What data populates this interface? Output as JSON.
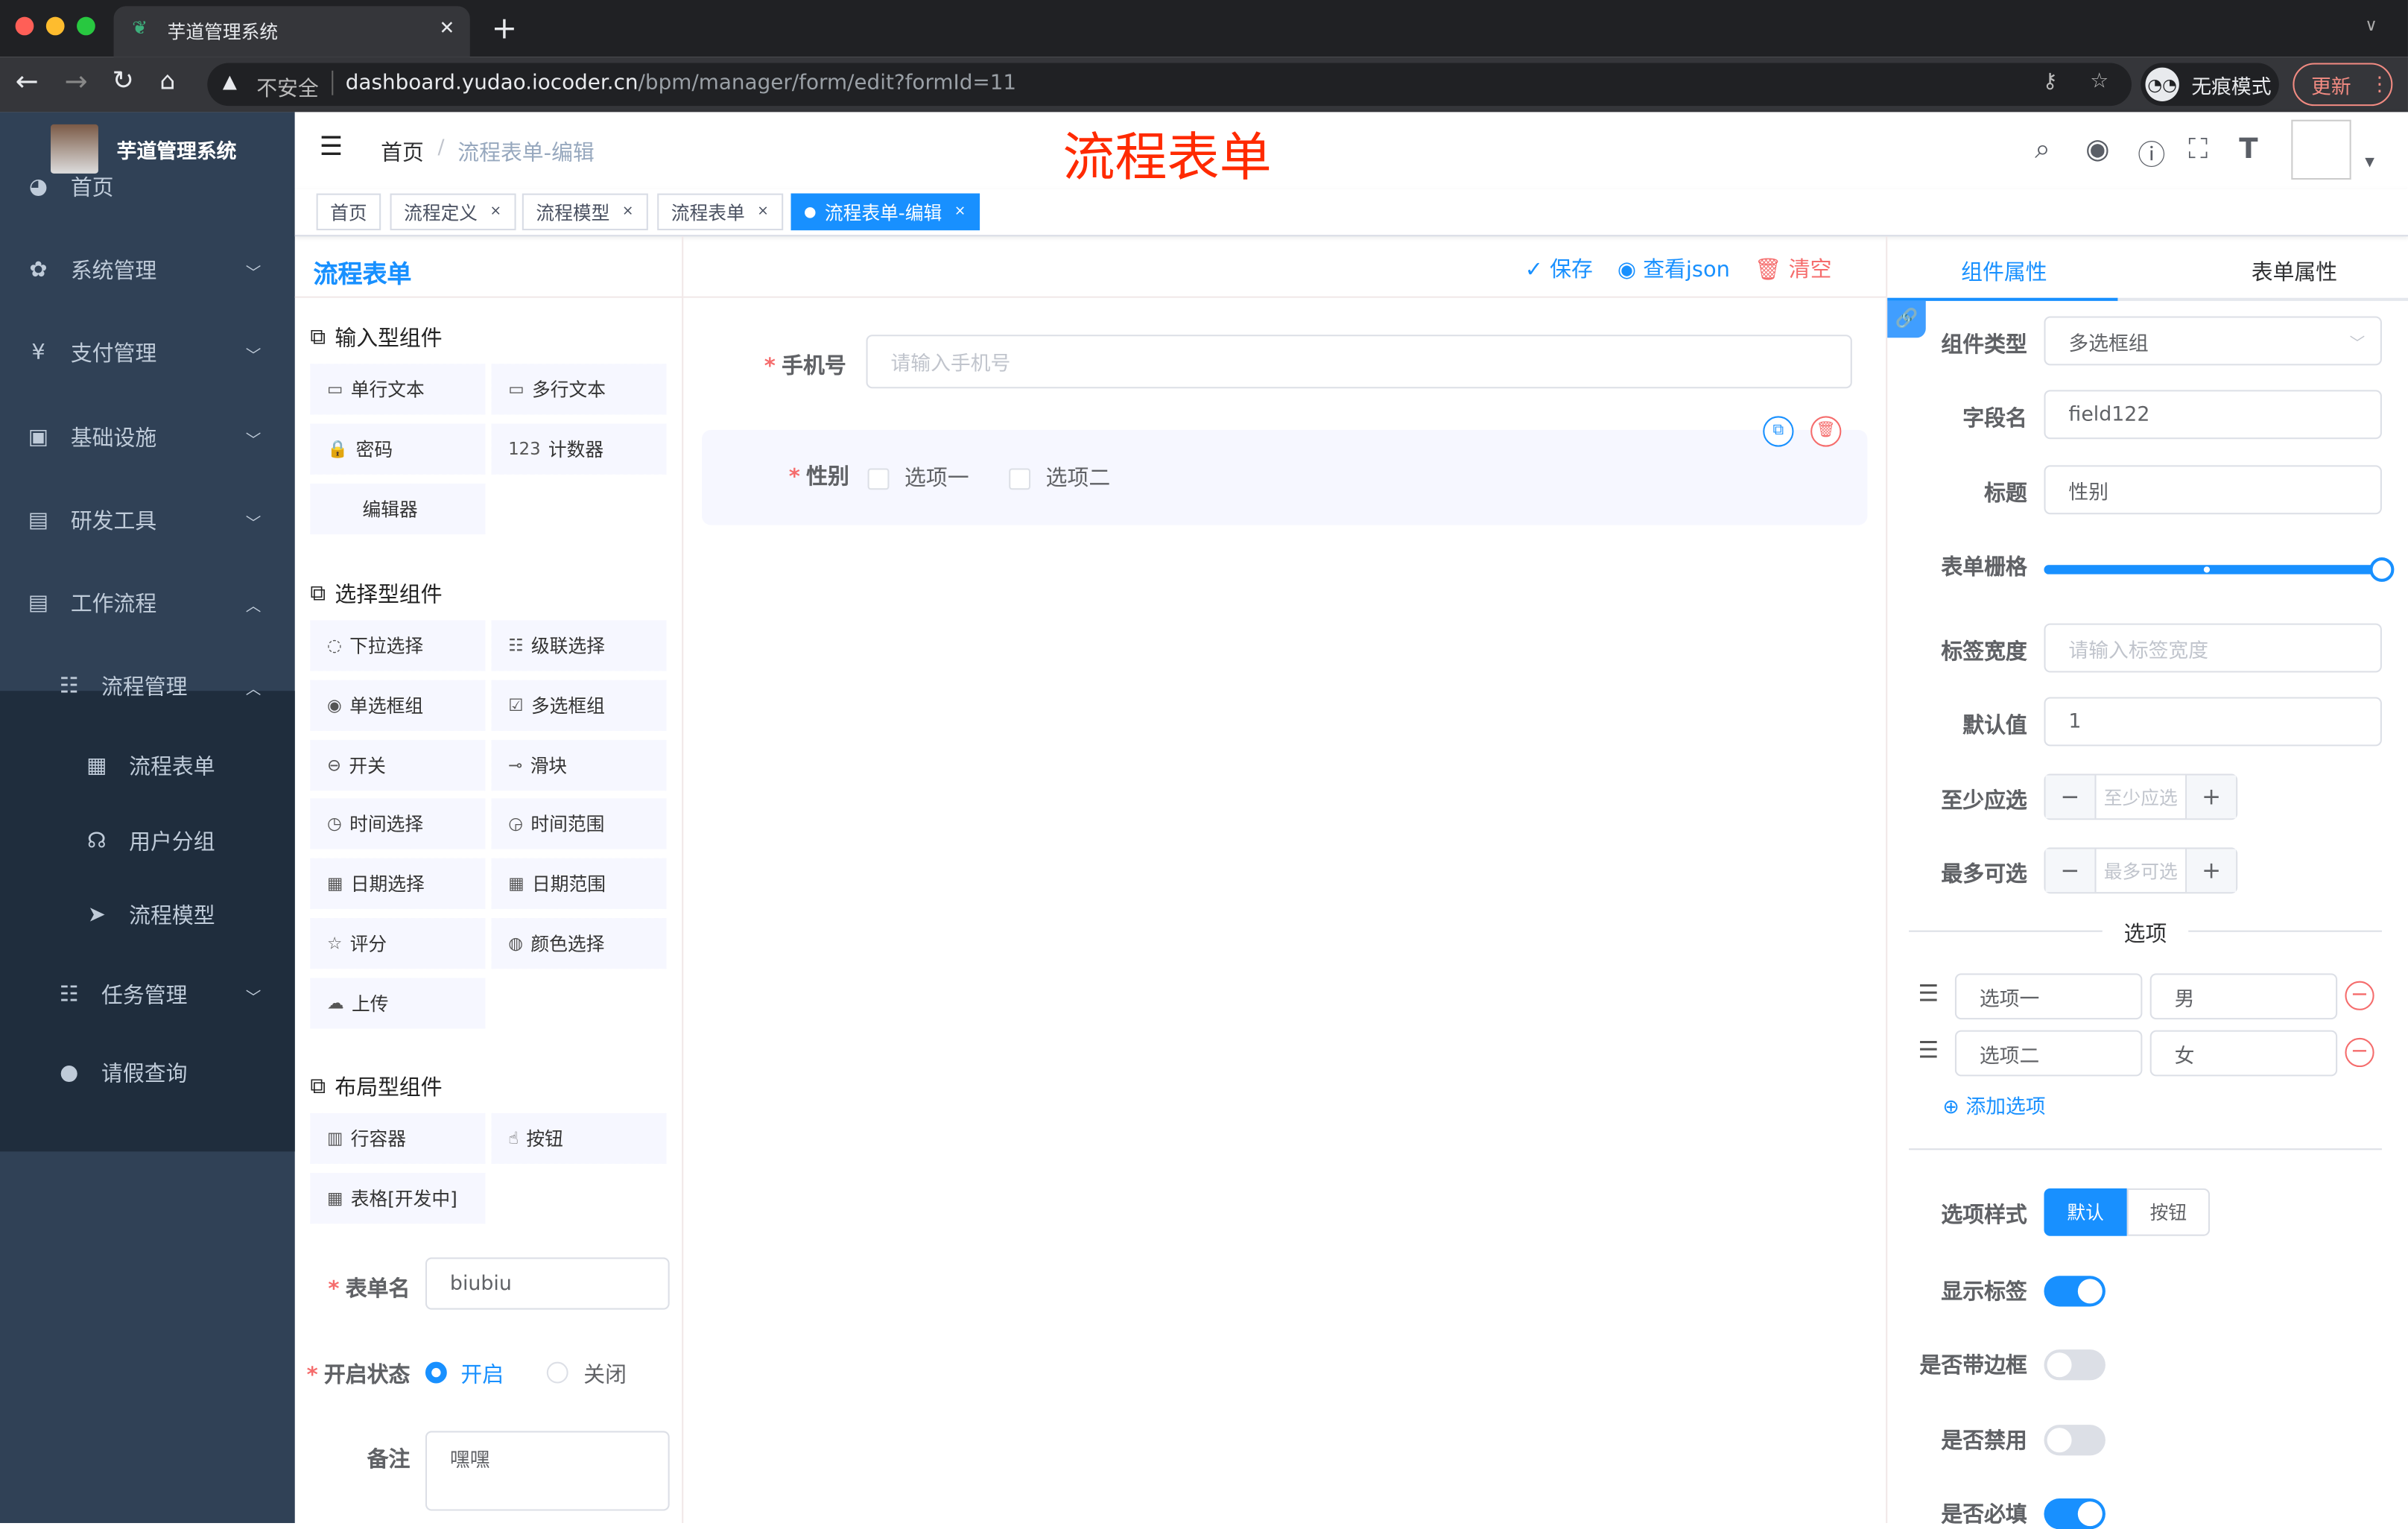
{
  "browser": {
    "tab_title": "芋道管理系统",
    "url_insecure": "不安全",
    "url_host": "dashboard.yudao.iocoder.cn",
    "url_path": "/bpm/manager/form/edit?formId=11",
    "incognito": "无痕模式",
    "update": "更新"
  },
  "sidebar": {
    "title": "芋道管理系统",
    "items": [
      {
        "label": "首页",
        "icon": "dashboard-icon"
      },
      {
        "label": "系统管理",
        "icon": "gear-icon"
      },
      {
        "label": "支付管理",
        "icon": "yen-icon"
      },
      {
        "label": "基础设施",
        "icon": "monitor-icon"
      },
      {
        "label": "研发工具",
        "icon": "toolbox-icon"
      },
      {
        "label": "工作流程",
        "icon": "toolbox-icon"
      },
      {
        "label": "流程管理",
        "icon": "tree-icon"
      },
      {
        "label": "流程表单",
        "icon": "form-icon"
      },
      {
        "label": "用户分组",
        "icon": "group-icon"
      },
      {
        "label": "流程模型",
        "icon": "send-icon"
      },
      {
        "label": "任务管理",
        "icon": "tree-icon"
      },
      {
        "label": "请假查询",
        "icon": "user-icon"
      }
    ]
  },
  "header": {
    "breadcrumb_home": "首页",
    "breadcrumb_current": "流程表单-编辑",
    "page_heading": "流程表单"
  },
  "tags": [
    {
      "label": "首页"
    },
    {
      "label": "流程定义"
    },
    {
      "label": "流程模型"
    },
    {
      "label": "流程表单"
    },
    {
      "label": "流程表单-编辑"
    }
  ],
  "toolbar": {
    "title": "流程表单",
    "save": "保存",
    "view_json": "查看json",
    "clear": "清空"
  },
  "components": {
    "input_group": "输入型组件",
    "input": [
      "单行文本",
      "多行文本",
      "密码",
      "计数器",
      "编辑器"
    ],
    "select_group": "选择型组件",
    "select": [
      "下拉选择",
      "级联选择",
      "单选框组",
      "多选框组",
      "开关",
      "滑块",
      "时间选择",
      "时间范围",
      "日期选择",
      "日期范围",
      "评分",
      "颜色选择",
      "上传"
    ],
    "layout_group": "布局型组件",
    "layout": [
      "行容器",
      "按钮",
      "表格[开发中]"
    ]
  },
  "form_meta": {
    "name_label": "表单名",
    "name_value": "biubiu",
    "status_label": "开启状态",
    "status_on": "开启",
    "status_off": "关闭",
    "status_selected": "开启",
    "remark_label": "备注",
    "remark_value": "嘿嘿"
  },
  "canvas": {
    "phone_label": "手机号",
    "phone_placeholder": "请输入手机号",
    "gender_label": "性别",
    "option1": "选项一",
    "option2": "选项二"
  },
  "props": {
    "tab_component": "组件属性",
    "tab_form": "表单属性",
    "active_tab": "组件属性",
    "type_label": "组件类型",
    "type_value": "多选框组",
    "field_label": "字段名",
    "field_value": "field122",
    "title_label": "标题",
    "title_value": "性别",
    "grid_label": "表单栅格",
    "grid_value": 24,
    "grid_max": 24,
    "label_width_label": "标签宽度",
    "label_width_placeholder": "请输入标签宽度",
    "default_label": "默认值",
    "default_value": "1",
    "min_label": "至少应选",
    "min_placeholder": "至少应选",
    "max_label": "最多可选",
    "max_placeholder": "最多可选",
    "options_divider": "选项",
    "options": [
      {
        "label": "选项一",
        "value": "男"
      },
      {
        "label": "选项二",
        "value": "女"
      }
    ],
    "add_option": "添加选项",
    "style_label": "选项样式",
    "style_default": "默认",
    "style_button": "按钮",
    "show_label": "显示标签",
    "show_label_on": true,
    "border_label": "是否带边框",
    "border_on": false,
    "disabled_label": "是否禁用",
    "disabled_on": false,
    "required_label": "是否必填",
    "required_on": true
  },
  "colors": {
    "primary": "#1890ff",
    "sidebar": "#304156",
    "danger": "#f56c6c",
    "heading": "#ff2a00"
  }
}
